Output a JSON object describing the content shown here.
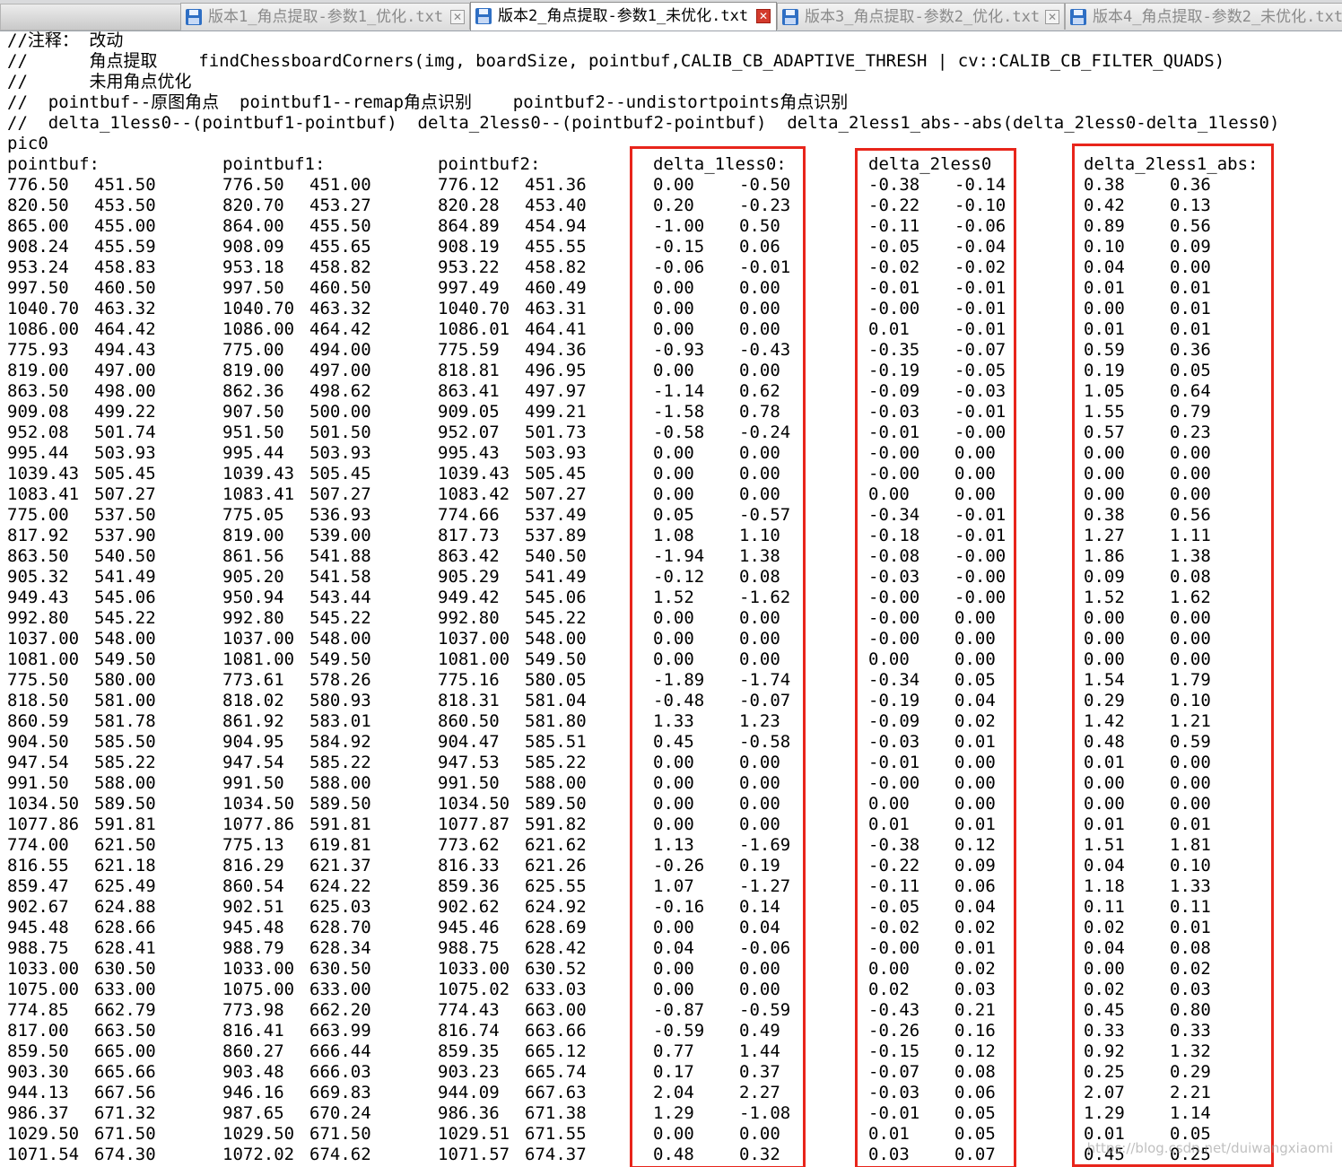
{
  "tabs": [
    {
      "label": "版本1_角点提取-参数1_优化.txt",
      "active": false
    },
    {
      "label": "版本2_角点提取-参数1_未优化.txt",
      "active": true
    },
    {
      "label": "版本3_角点提取-参数2_优化.txt",
      "active": false
    },
    {
      "label": "版本4_角点提取-参数2_未优化.txt",
      "active": false
    }
  ],
  "close_glyph": "✕",
  "comment_lines": [
    "//注释： 改动",
    "//      角点提取    findChessboardCorners(img, boardSize, pointbuf,CALIB_CB_ADAPTIVE_THRESH | cv::CALIB_CB_FILTER_QUADS)",
    "//      未用角点优化",
    "//  pointbuf--原图角点  pointbuf1--remap角点识别    pointbuf2--undistortpoints角点识别",
    "//  delta_1less0--(pointbuf1-pointbuf)  delta_2less0--(pointbuf2-pointbuf)  delta_2less1_abs--abs(delta_2less0-delta_1less0)"
  ],
  "pic_label": "pic0",
  "headers": [
    "pointbuf:",
    "pointbuf1:",
    "pointbuf2:",
    "delta_1less0:",
    "delta_2less0",
    "delta_2less1_abs:"
  ],
  "rows": [
    [
      "776.50",
      "451.50",
      "776.50",
      "451.00",
      "776.12",
      "451.36",
      "0.00",
      "-0.50",
      "-0.38",
      "-0.14",
      "0.38",
      "0.36"
    ],
    [
      "820.50",
      "453.50",
      "820.70",
      "453.27",
      "820.28",
      "453.40",
      "0.20",
      "-0.23",
      "-0.22",
      "-0.10",
      "0.42",
      "0.13"
    ],
    [
      "865.00",
      "455.00",
      "864.00",
      "455.50",
      "864.89",
      "454.94",
      "-1.00",
      "0.50",
      "-0.11",
      "-0.06",
      "0.89",
      "0.56"
    ],
    [
      "908.24",
      "455.59",
      "908.09",
      "455.65",
      "908.19",
      "455.55",
      "-0.15",
      "0.06",
      "-0.05",
      "-0.04",
      "0.10",
      "0.09"
    ],
    [
      "953.24",
      "458.83",
      "953.18",
      "458.82",
      "953.22",
      "458.82",
      "-0.06",
      "-0.01",
      "-0.02",
      "-0.02",
      "0.04",
      "0.00"
    ],
    [
      "997.50",
      "460.50",
      "997.50",
      "460.50",
      "997.49",
      "460.49",
      "0.00",
      "0.00",
      "-0.01",
      "-0.01",
      "0.01",
      "0.01"
    ],
    [
      "1040.70",
      "463.32",
      "1040.70",
      "463.32",
      "1040.70",
      "463.31",
      "0.00",
      "0.00",
      "-0.00",
      "-0.01",
      "0.00",
      "0.01"
    ],
    [
      "1086.00",
      "464.42",
      "1086.00",
      "464.42",
      "1086.01",
      "464.41",
      "0.00",
      "0.00",
      "0.01",
      "-0.01",
      "0.01",
      "0.01"
    ],
    [
      "775.93",
      "494.43",
      "775.00",
      "494.00",
      "775.59",
      "494.36",
      "-0.93",
      "-0.43",
      "-0.35",
      "-0.07",
      "0.59",
      "0.36"
    ],
    [
      "819.00",
      "497.00",
      "819.00",
      "497.00",
      "818.81",
      "496.95",
      "0.00",
      "0.00",
      "-0.19",
      "-0.05",
      "0.19",
      "0.05"
    ],
    [
      "863.50",
      "498.00",
      "862.36",
      "498.62",
      "863.41",
      "497.97",
      "-1.14",
      "0.62",
      "-0.09",
      "-0.03",
      "1.05",
      "0.64"
    ],
    [
      "909.08",
      "499.22",
      "907.50",
      "500.00",
      "909.05",
      "499.21",
      "-1.58",
      "0.78",
      "-0.03",
      "-0.01",
      "1.55",
      "0.79"
    ],
    [
      "952.08",
      "501.74",
      "951.50",
      "501.50",
      "952.07",
      "501.73",
      "-0.58",
      "-0.24",
      "-0.01",
      "-0.00",
      "0.57",
      "0.23"
    ],
    [
      "995.44",
      "503.93",
      "995.44",
      "503.93",
      "995.43",
      "503.93",
      "0.00",
      "0.00",
      "-0.00",
      "0.00",
      "0.00",
      "0.00"
    ],
    [
      "1039.43",
      "505.45",
      "1039.43",
      "505.45",
      "1039.43",
      "505.45",
      "0.00",
      "0.00",
      "-0.00",
      "0.00",
      "0.00",
      "0.00"
    ],
    [
      "1083.41",
      "507.27",
      "1083.41",
      "507.27",
      "1083.42",
      "507.27",
      "0.00",
      "0.00",
      "0.00",
      "0.00",
      "0.00",
      "0.00"
    ],
    [
      "775.00",
      "537.50",
      "775.05",
      "536.93",
      "774.66",
      "537.49",
      "0.05",
      "-0.57",
      "-0.34",
      "-0.01",
      "0.38",
      "0.56"
    ],
    [
      "817.92",
      "537.90",
      "819.00",
      "539.00",
      "817.73",
      "537.89",
      "1.08",
      "1.10",
      "-0.18",
      "-0.01",
      "1.27",
      "1.11"
    ],
    [
      "863.50",
      "540.50",
      "861.56",
      "541.88",
      "863.42",
      "540.50",
      "-1.94",
      "1.38",
      "-0.08",
      "-0.00",
      "1.86",
      "1.38"
    ],
    [
      "905.32",
      "541.49",
      "905.20",
      "541.58",
      "905.29",
      "541.49",
      "-0.12",
      "0.08",
      "-0.03",
      "-0.00",
      "0.09",
      "0.08"
    ],
    [
      "949.43",
      "545.06",
      "950.94",
      "543.44",
      "949.42",
      "545.06",
      "1.52",
      "-1.62",
      "-0.00",
      "-0.00",
      "1.52",
      "1.62"
    ],
    [
      "992.80",
      "545.22",
      "992.80",
      "545.22",
      "992.80",
      "545.22",
      "0.00",
      "0.00",
      "-0.00",
      "0.00",
      "0.00",
      "0.00"
    ],
    [
      "1037.00",
      "548.00",
      "1037.00",
      "548.00",
      "1037.00",
      "548.00",
      "0.00",
      "0.00",
      "-0.00",
      "0.00",
      "0.00",
      "0.00"
    ],
    [
      "1081.00",
      "549.50",
      "1081.00",
      "549.50",
      "1081.00",
      "549.50",
      "0.00",
      "0.00",
      "0.00",
      "0.00",
      "0.00",
      "0.00"
    ],
    [
      "775.50",
      "580.00",
      "773.61",
      "578.26",
      "775.16",
      "580.05",
      "-1.89",
      "-1.74",
      "-0.34",
      "0.05",
      "1.54",
      "1.79"
    ],
    [
      "818.50",
      "581.00",
      "818.02",
      "580.93",
      "818.31",
      "581.04",
      "-0.48",
      "-0.07",
      "-0.19",
      "0.04",
      "0.29",
      "0.10"
    ],
    [
      "860.59",
      "581.78",
      "861.92",
      "583.01",
      "860.50",
      "581.80",
      "1.33",
      "1.23",
      "-0.09",
      "0.02",
      "1.42",
      "1.21"
    ],
    [
      "904.50",
      "585.50",
      "904.95",
      "584.92",
      "904.47",
      "585.51",
      "0.45",
      "-0.58",
      "-0.03",
      "0.01",
      "0.48",
      "0.59"
    ],
    [
      "947.54",
      "585.22",
      "947.54",
      "585.22",
      "947.53",
      "585.22",
      "0.00",
      "0.00",
      "-0.01",
      "0.00",
      "0.01",
      "0.00"
    ],
    [
      "991.50",
      "588.00",
      "991.50",
      "588.00",
      "991.50",
      "588.00",
      "0.00",
      "0.00",
      "-0.00",
      "0.00",
      "0.00",
      "0.00"
    ],
    [
      "1034.50",
      "589.50",
      "1034.50",
      "589.50",
      "1034.50",
      "589.50",
      "0.00",
      "0.00",
      "0.00",
      "0.00",
      "0.00",
      "0.00"
    ],
    [
      "1077.86",
      "591.81",
      "1077.86",
      "591.81",
      "1077.87",
      "591.82",
      "0.00",
      "0.00",
      "0.01",
      "0.01",
      "0.01",
      "0.01"
    ],
    [
      "774.00",
      "621.50",
      "775.13",
      "619.81",
      "773.62",
      "621.62",
      "1.13",
      "-1.69",
      "-0.38",
      "0.12",
      "1.51",
      "1.81"
    ],
    [
      "816.55",
      "621.18",
      "816.29",
      "621.37",
      "816.33",
      "621.26",
      "-0.26",
      "0.19",
      "-0.22",
      "0.09",
      "0.04",
      "0.10"
    ],
    [
      "859.47",
      "625.49",
      "860.54",
      "624.22",
      "859.36",
      "625.55",
      "1.07",
      "-1.27",
      "-0.11",
      "0.06",
      "1.18",
      "1.33"
    ],
    [
      "902.67",
      "624.88",
      "902.51",
      "625.03",
      "902.62",
      "624.92",
      "-0.16",
      "0.14",
      "-0.05",
      "0.04",
      "0.11",
      "0.11"
    ],
    [
      "945.48",
      "628.66",
      "945.48",
      "628.70",
      "945.46",
      "628.69",
      "0.00",
      "0.04",
      "-0.02",
      "0.02",
      "0.02",
      "0.01"
    ],
    [
      "988.75",
      "628.41",
      "988.79",
      "628.34",
      "988.75",
      "628.42",
      "0.04",
      "-0.06",
      "-0.00",
      "0.01",
      "0.04",
      "0.08"
    ],
    [
      "1033.00",
      "630.50",
      "1033.00",
      "630.50",
      "1033.00",
      "630.52",
      "0.00",
      "0.00",
      "0.00",
      "0.02",
      "0.00",
      "0.02"
    ],
    [
      "1075.00",
      "633.00",
      "1075.00",
      "633.00",
      "1075.02",
      "633.03",
      "0.00",
      "0.00",
      "0.02",
      "0.03",
      "0.02",
      "0.03"
    ],
    [
      "774.85",
      "662.79",
      "773.98",
      "662.20",
      "774.43",
      "663.00",
      "-0.87",
      "-0.59",
      "-0.43",
      "0.21",
      "0.45",
      "0.80"
    ],
    [
      "817.00",
      "663.50",
      "816.41",
      "663.99",
      "816.74",
      "663.66",
      "-0.59",
      "0.49",
      "-0.26",
      "0.16",
      "0.33",
      "0.33"
    ],
    [
      "859.50",
      "665.00",
      "860.27",
      "666.44",
      "859.35",
      "665.12",
      "0.77",
      "1.44",
      "-0.15",
      "0.12",
      "0.92",
      "1.32"
    ],
    [
      "903.30",
      "665.66",
      "903.48",
      "666.03",
      "903.23",
      "665.74",
      "0.17",
      "0.37",
      "-0.07",
      "0.08",
      "0.25",
      "0.29"
    ],
    [
      "944.13",
      "667.56",
      "946.16",
      "669.83",
      "944.09",
      "667.63",
      "2.04",
      "2.27",
      "-0.03",
      "0.06",
      "2.07",
      "2.21"
    ],
    [
      "986.37",
      "671.32",
      "987.65",
      "670.24",
      "986.36",
      "671.38",
      "1.29",
      "-1.08",
      "-0.01",
      "0.05",
      "1.29",
      "1.14"
    ],
    [
      "1029.50",
      "671.50",
      "1029.50",
      "671.50",
      "1029.51",
      "671.55",
      "0.00",
      "0.00",
      "0.01",
      "0.05",
      "0.01",
      "0.05"
    ],
    [
      "1071.54",
      "674.30",
      "1072.02",
      "674.62",
      "1071.57",
      "674.37",
      "0.48",
      "0.32",
      "0.03",
      "0.07",
      "0.45",
      "0.25"
    ]
  ],
  "watermark": "https://blog.csdn.net/duiwangxiaomi",
  "colors": {
    "highlight_box": "#e8251b",
    "close_active": "#d33a2c",
    "save_icon": "#2f6fc4"
  }
}
